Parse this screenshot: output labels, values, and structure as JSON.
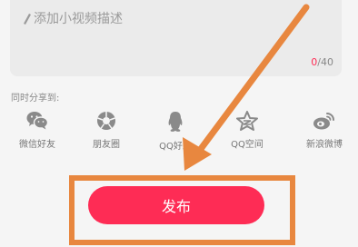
{
  "description": {
    "placeholder": "添加小视频描述",
    "counter_current": "0",
    "counter_max": "/40"
  },
  "share": {
    "title": "同时分享到:",
    "items": [
      {
        "label": "微信好友",
        "icon": "wechat-icon"
      },
      {
        "label": "朋友圈",
        "icon": "moments-icon"
      },
      {
        "label": "QQ好友",
        "icon": "qq-icon"
      },
      {
        "label": "QQ空间",
        "icon": "qzone-icon"
      },
      {
        "label": "新浪微博",
        "icon": "weibo-icon"
      }
    ]
  },
  "publish_label": "发布",
  "colors": {
    "accent": "#fe2c55",
    "annotation": "#e8873f",
    "icon_gray": "#8a8a8a"
  }
}
